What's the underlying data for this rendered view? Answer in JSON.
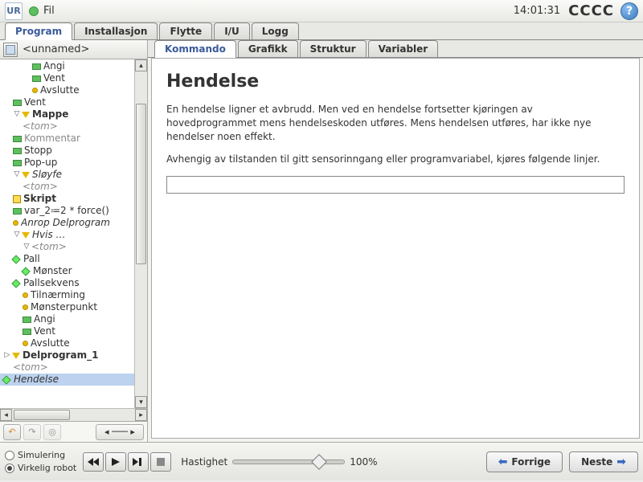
{
  "topbar": {
    "logo_text": "UR",
    "file_menu": "Fil",
    "clock": "14:01:31",
    "cccc": "CCCC",
    "help": "?"
  },
  "main_tabs": [
    "Program",
    "Installasjon",
    "Flytte",
    "I/U",
    "Logg"
  ],
  "main_tab_active": 0,
  "program_name": "<unnamed>",
  "tree": [
    {
      "lvl": 3,
      "icon": "rect",
      "label": "Angi"
    },
    {
      "lvl": 3,
      "icon": "rect",
      "label": "Vent"
    },
    {
      "lvl": 3,
      "icon": "dot",
      "label": "Avslutte"
    },
    {
      "lvl": 1,
      "icon": "rect",
      "label": "Vent"
    },
    {
      "lvl": 1,
      "twist": "▽",
      "icon": "tri",
      "label": "Mappe",
      "bold": true
    },
    {
      "lvl": 2,
      "icon": "",
      "label": "<tom>",
      "ital": true
    },
    {
      "lvl": 1,
      "icon": "rect",
      "label": "Kommentar",
      "grey": true
    },
    {
      "lvl": 1,
      "icon": "rect",
      "label": "Stopp"
    },
    {
      "lvl": 1,
      "icon": "rect",
      "label": "Pop-up"
    },
    {
      "lvl": 1,
      "twist": "▽",
      "icon": "tri",
      "label": "Sløyfe",
      "und": true
    },
    {
      "lvl": 2,
      "icon": "",
      "label": "<tom>",
      "ital": true
    },
    {
      "lvl": 1,
      "icon": "script",
      "label": "Skript",
      "bold": true
    },
    {
      "lvl": 1,
      "icon": "rect",
      "label": "var_2≔2 * force()"
    },
    {
      "lvl": 1,
      "icon": "dot",
      "label": "Anrop Delprogram",
      "und": true
    },
    {
      "lvl": 1,
      "twist": "▽",
      "icon": "tri",
      "label": "Hvis …",
      "und": true
    },
    {
      "lvl": 2,
      "twist": "▽",
      "icon": "",
      "label": "<tom>",
      "ital": true
    },
    {
      "lvl": 1,
      "icon": "dia",
      "label": "Pall"
    },
    {
      "lvl": 2,
      "icon": "dia",
      "label": "Mønster"
    },
    {
      "lvl": 1,
      "icon": "dia",
      "label": "Pallsekvens"
    },
    {
      "lvl": 2,
      "icon": "dot",
      "label": "Tilnærming"
    },
    {
      "lvl": 2,
      "icon": "dot",
      "label": "Mønsterpunkt"
    },
    {
      "lvl": 2,
      "icon": "rect",
      "label": "Angi"
    },
    {
      "lvl": 2,
      "icon": "rect",
      "label": "Vent"
    },
    {
      "lvl": 2,
      "icon": "dot",
      "label": "Avslutte"
    },
    {
      "lvl": 0,
      "twist": "▷",
      "icon": "tri",
      "label": "Delprogram_1",
      "bold": true
    },
    {
      "lvl": 1,
      "icon": "",
      "label": "<tom>",
      "ital": true
    },
    {
      "lvl": 0,
      "icon": "dia",
      "label": "Hendelse",
      "sel": true,
      "und": true
    }
  ],
  "sub_tabs": [
    "Kommando",
    "Grafikk",
    "Struktur",
    "Variabler"
  ],
  "sub_tab_active": 0,
  "command": {
    "title": "Hendelse",
    "p1": "En hendelse ligner et avbrudd. Men ved en hendelse fortsetter kjøringen av hovedprogrammet mens hendelseskoden utføres. Mens hendelsen utføres, har ikke nye hendelser noen effekt.",
    "p2": "Avhengig av tilstanden til gitt sensorinngang eller programvariabel, kjøres følgende linjer."
  },
  "footer": {
    "sim": "Simulering",
    "real": "Virkelig robot",
    "speed_label": "Hastighet",
    "speed_value": "100%",
    "prev": "Forrige",
    "next": "Neste"
  }
}
